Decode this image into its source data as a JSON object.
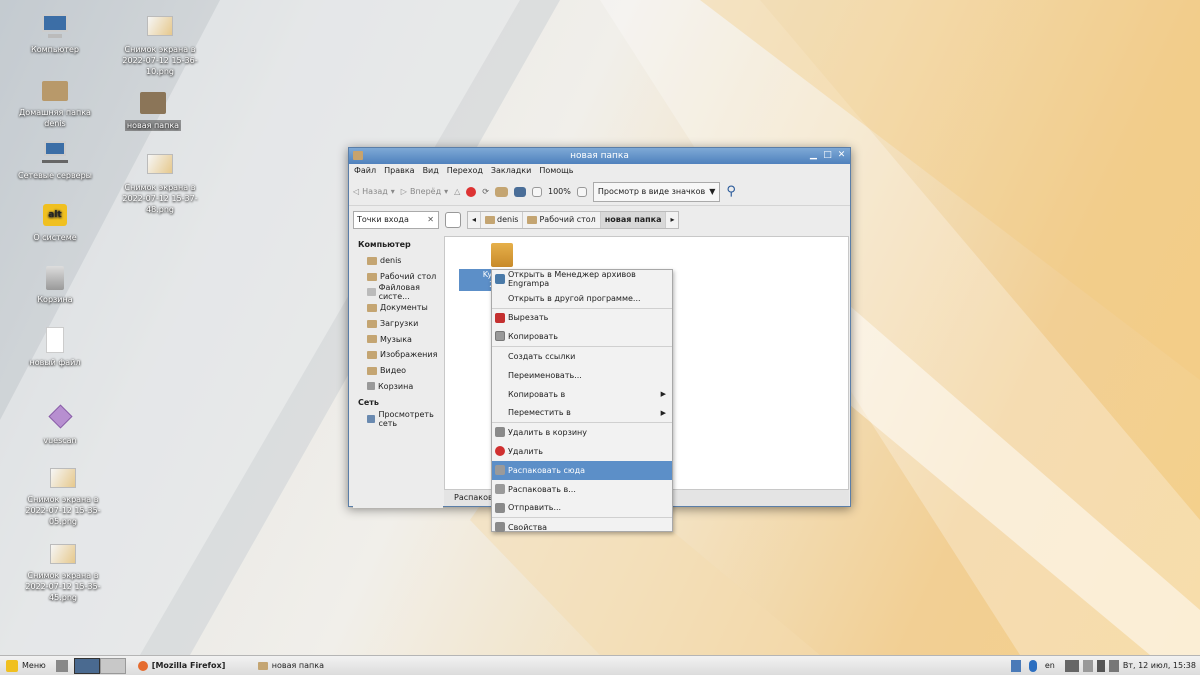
{
  "desktop": {
    "icons": [
      {
        "label": "Компьютер",
        "icon": "computer-icon"
      },
      {
        "label": "Домашняя папка denis",
        "icon": "home-folder-icon"
      },
      {
        "label": "Сетевые серверы",
        "icon": "network-icon"
      },
      {
        "label": "О системе",
        "icon": "about-system-icon"
      },
      {
        "label": "Корзина",
        "icon": "trash-icon"
      },
      {
        "label": "новый файл",
        "icon": "file-icon"
      },
      {
        "label": "vuescan",
        "icon": "vuescan-icon"
      },
      {
        "label": "Снимок экрана в 2022-07-12 15-35-05.png",
        "icon": "image-file-icon"
      },
      {
        "label": "Снимок экрана в 2022-07-12 15-35-45.png",
        "icon": "image-file-icon"
      },
      {
        "label": "Снимок экрана в 2022-07-12 15-36-10.png",
        "icon": "image-file-icon"
      },
      {
        "label": "новая папка",
        "icon": "folder-icon"
      },
      {
        "label": "Снимок экрана в 2022-07-12 15-37-48.png",
        "icon": "image-file-icon"
      }
    ]
  },
  "window": {
    "title": "новая папка",
    "menu": [
      "Файл",
      "Правка",
      "Вид",
      "Переход",
      "Закладки",
      "Помощь"
    ],
    "toolbar": {
      "back": "Назад",
      "forward": "Вперёд",
      "zoom": "100%",
      "view_mode": "Просмотр в виде значков"
    },
    "location": {
      "places_combo": "Точки входа",
      "crumbs": [
        "denis",
        "Рабочий стол",
        "новая папка"
      ]
    },
    "sidebar": {
      "computer_header": "Компьютер",
      "computer_items": [
        "denis",
        "Рабочий стол",
        "Файловая систе...",
        "Документы",
        "Загрузки",
        "Музыка",
        "Изображения",
        "Видео",
        "Корзина"
      ],
      "network_header": "Сеть",
      "network_items": [
        "Просмотреть сеть"
      ]
    },
    "file": {
      "name_line1": "KyoceraLi",
      "name_line2": "20191"
    },
    "status": "Распакова"
  },
  "context_menu": [
    {
      "label": "Открыть в Менеджер архивов Engrampa",
      "icon": "engrampa-icon",
      "color": "#4a7aa8"
    },
    {
      "label": "Открыть в другой программе...",
      "sep_after": true
    },
    {
      "label": "Вырезать",
      "icon": "cut-icon",
      "color": "#c43030"
    },
    {
      "label": "Копировать",
      "icon": "copy-icon",
      "color": "#999999",
      "sep_after": true
    },
    {
      "label": "Создать ссылки"
    },
    {
      "label": "Переименовать..."
    },
    {
      "label": "Копировать в",
      "submenu": true
    },
    {
      "label": "Переместить в",
      "submenu": true,
      "sep_after": true
    },
    {
      "label": "Удалить в корзину",
      "icon": "trash-icon",
      "color": "#8a8a8a"
    },
    {
      "label": "Удалить",
      "icon": "delete-icon",
      "color": "#d03030"
    },
    {
      "label": "Распаковать сюда",
      "icon": "extract-icon",
      "color": "#9a9a9a",
      "highlighted": true
    },
    {
      "label": "Распаковать в...",
      "icon": "extract-to-icon",
      "color": "#9a9a9a"
    },
    {
      "label": "Отправить...",
      "icon": "send-icon",
      "color": "#8a8a8a",
      "sep_after": true
    },
    {
      "label": "Свойства",
      "icon": "properties-icon",
      "color": "#8a8a8a"
    }
  ],
  "taskbar": {
    "menu_label": "Меню",
    "firefox_task": "[Mozilla Firefox]",
    "folder_task": "новая папка",
    "lang": "en",
    "clock": "Вт, 12 июл, 15:38"
  }
}
